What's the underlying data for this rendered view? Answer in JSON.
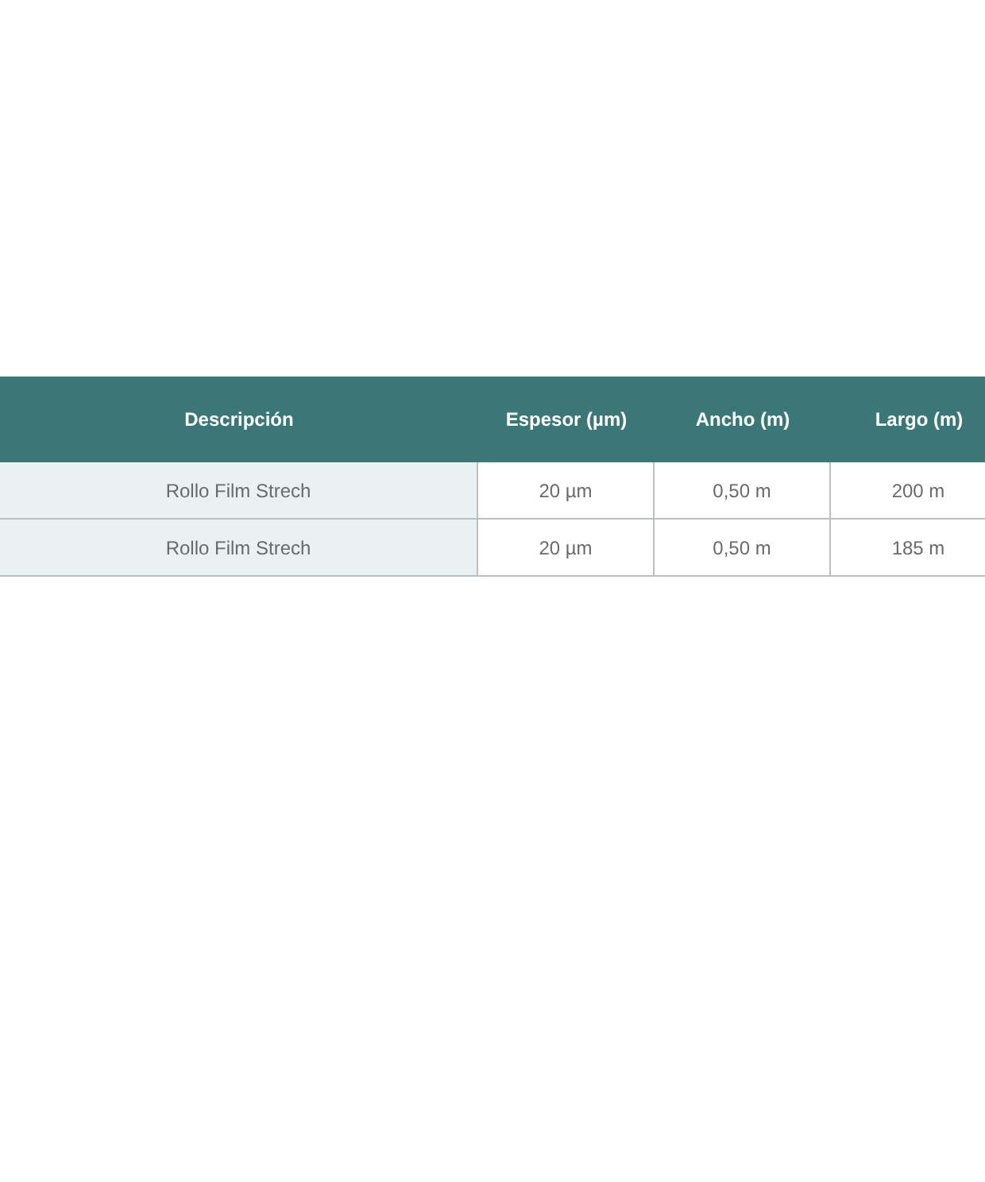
{
  "table": {
    "columns": [
      "Descripción",
      "Espesor (µm)",
      "Ancho (m)",
      "Largo (m)"
    ],
    "rows": [
      [
        "Rollo Film Strech",
        "20 µm",
        "0,50 m",
        "200 m"
      ],
      [
        "Rollo Film Strech",
        "20 µm",
        "0,50 m",
        "185 m"
      ]
    ]
  }
}
